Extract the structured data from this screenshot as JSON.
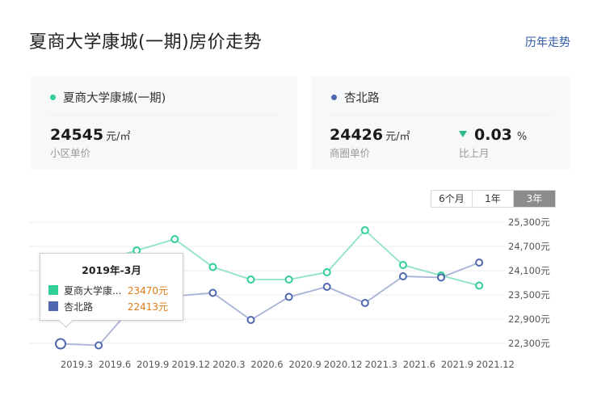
{
  "header": {
    "title": "夏商大学康城(一期)房价走势",
    "history_link": "历年走势"
  },
  "colors": {
    "community": "#2fcf95",
    "community_line": "#8fe3c4",
    "road": "#5068b0",
    "road_line": "#a8b3d6",
    "down": "#2bb88a",
    "tooltip_value": "#e07b1a"
  },
  "cards": {
    "community": {
      "name": "夏商大学康城(一期)",
      "price": "24545",
      "unit": "元/㎡",
      "label": "小区单价"
    },
    "road": {
      "name": "杏北路",
      "price": "24426",
      "unit": "元/㎡",
      "label": "商圈单价",
      "change_value": "0.03",
      "change_unit": "%",
      "change_label": "比上月",
      "change_direction": "down"
    }
  },
  "range_toggle": {
    "options": [
      "6个月",
      "1年",
      "3年"
    ],
    "selected": "3年"
  },
  "tooltip": {
    "title": "2019年-3月",
    "rows": [
      {
        "name": "夏商大学康...",
        "value": "23470元"
      },
      {
        "name": "杏北路",
        "value": "22413元"
      }
    ]
  },
  "chart_data": {
    "type": "line",
    "x": [
      "2019.3",
      "2019.6",
      "2019.9",
      "2019.12",
      "2020.3",
      "2020.6",
      "2020.9",
      "2020.12",
      "2021.3",
      "2021.6",
      "2021.9",
      "2021.12"
    ],
    "x_tick_labels": [
      "2019.3",
      "2019.6",
      "2019.9",
      "2019.12",
      "2020.3",
      "2020.6",
      "2020.9",
      "2020.12",
      "2021.3",
      "2021.6",
      "2021.9",
      "2021.12"
    ],
    "series": [
      {
        "name": "夏商大学康城(一期)",
        "values": [
          23470,
          24330,
          24600,
          24880,
          24190,
          23880,
          23880,
          24060,
          25100,
          24240,
          23980,
          23730
        ]
      },
      {
        "name": "杏北路",
        "values": [
          22290,
          22250,
          23330,
          23470,
          23550,
          22880,
          23450,
          23700,
          23300,
          23960,
          23930,
          24300
        ]
      }
    ],
    "y_ticks": [
      "25,300元",
      "24,700元",
      "24,100元",
      "23,500元",
      "22,900元",
      "22,300元"
    ],
    "y_tick_values": [
      25300,
      24700,
      24100,
      23500,
      22900,
      22300
    ],
    "ylim": [
      22300,
      25300
    ],
    "grid": true,
    "highlighted_index": 0
  }
}
